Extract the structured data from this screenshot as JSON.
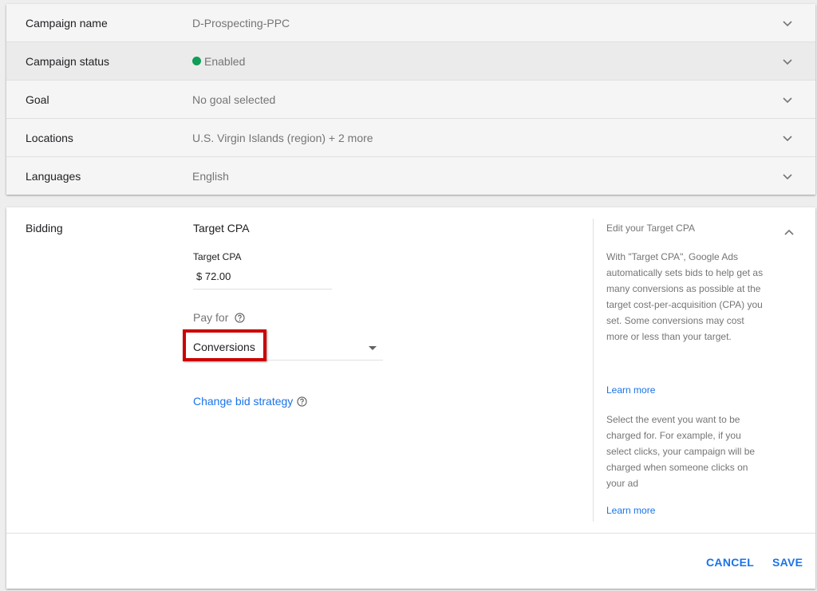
{
  "settings": [
    {
      "label": "Campaign name",
      "value": "D-Prospecting-PPC",
      "highlight": false
    },
    {
      "label": "Campaign status",
      "value": "Enabled",
      "highlight": true,
      "status_color": "#0f9d58"
    },
    {
      "label": "Goal",
      "value": "No goal selected",
      "highlight": false
    },
    {
      "label": "Locations",
      "value": "U.S. Virgin Islands (region) + 2 more",
      "highlight": false
    },
    {
      "label": "Languages",
      "value": "English",
      "highlight": false
    }
  ],
  "bidding": {
    "label": "Bidding",
    "strategy": "Target CPA",
    "target_cpa_label": "Target CPA",
    "target_cpa_value": "$ 72.00",
    "pay_for_label": "Pay for",
    "pay_for_value": "Conversions",
    "change_bid_strategy": "Change bid strategy"
  },
  "help_panel": {
    "title": "Edit your Target CPA",
    "paragraph1": "With \"Target CPA\", Google Ads automatically sets bids to help get as many conversions as possible at the target cost-per-acquisition (CPA) you set. Some conversions may cost more or less than your target.",
    "learn_more_1": "Learn more",
    "paragraph2": "Select the event you want to be charged for. For example, if you select clicks, your campaign will be charged when someone clicks on your ad",
    "learn_more_2": "Learn more"
  },
  "footer": {
    "cancel": "CANCEL",
    "save": "SAVE"
  },
  "icons": {
    "row_expand": "chevron-down-icon",
    "help": "help-circle-icon",
    "panel_collapse": "chevron-up-icon",
    "dropdown": "dropdown-arrow-icon"
  },
  "colors": {
    "accent": "#1a73e8",
    "enabled_status": "#0f9d58",
    "highlight_box": "#cc0000"
  }
}
